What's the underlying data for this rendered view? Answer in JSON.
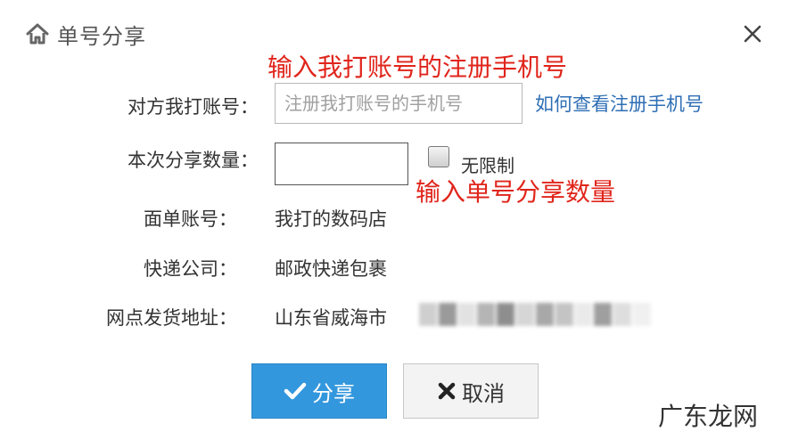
{
  "dialog": {
    "title": "单号分享",
    "icons": {
      "title": "home-icon",
      "close": "close-icon",
      "share": "checkmark-icon",
      "cancel": "x-icon"
    }
  },
  "annotations": {
    "phone_hint": "输入我打账号的注册手机号",
    "quantity_hint": "输入单号分享数量"
  },
  "form": {
    "phone_label": "对方我打账号：",
    "phone_value": "",
    "phone_placeholder": "注册我打账号的手机号",
    "help_link": "如何查看注册手机号",
    "quantity_label": "本次分享数量：",
    "quantity_value": "",
    "unlimited_label": "无限制",
    "unlimited_checked": false,
    "waybill_account_label": "面单账号：",
    "waybill_account_value": "我打的数码店",
    "courier_label": "快递公司：",
    "courier_value": "邮政快递包裹",
    "address_label": "网点发货地址：",
    "address_value": "山东省威海市"
  },
  "buttons": {
    "share_label": "分享",
    "cancel_label": "取消"
  },
  "colors": {
    "accent": "#3397dd",
    "annotation": "#e0251b",
    "link": "#2f6fb5"
  },
  "watermark": "广东龙网"
}
